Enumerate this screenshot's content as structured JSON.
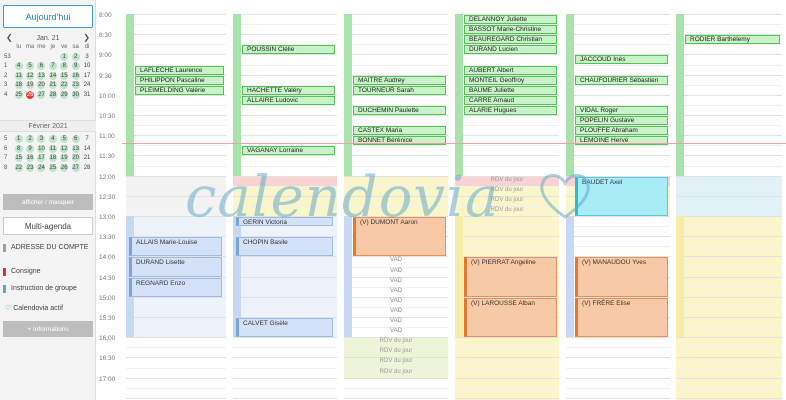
{
  "sidebar": {
    "today_button": "Aujourd'hui",
    "jan": {
      "title": "Jan. 21",
      "dow": [
        "lu",
        "ma",
        "me",
        "je",
        "ve",
        "sa",
        "di"
      ],
      "weeks": [
        {
          "wk": "53",
          "days": [
            "",
            "",
            "",
            "",
            "1",
            "2",
            "3"
          ],
          "av": [
            0,
            0,
            0,
            0,
            1,
            1,
            0
          ]
        },
        {
          "wk": "1",
          "days": [
            "4",
            "5",
            "6",
            "7",
            "8",
            "9",
            "10"
          ],
          "av": [
            1,
            1,
            1,
            1,
            1,
            1,
            0
          ]
        },
        {
          "wk": "2",
          "days": [
            "11",
            "12",
            "13",
            "14",
            "15",
            "16",
            "17"
          ],
          "av": [
            1,
            1,
            1,
            1,
            1,
            1,
            0
          ]
        },
        {
          "wk": "3",
          "days": [
            "18",
            "19",
            "20",
            "21",
            "22",
            "23",
            "24"
          ],
          "av": [
            1,
            1,
            1,
            1,
            1,
            1,
            0
          ]
        },
        {
          "wk": "4",
          "days": [
            "25",
            "26",
            "27",
            "28",
            "29",
            "30",
            "31"
          ],
          "av": [
            1,
            2,
            1,
            1,
            1,
            1,
            0
          ]
        }
      ]
    },
    "feb": {
      "title": "Février 2021",
      "weeks": [
        {
          "wk": "5",
          "days": [
            "1",
            "2",
            "3",
            "4",
            "5",
            "6",
            "7"
          ],
          "av": [
            1,
            1,
            1,
            1,
            1,
            1,
            0
          ]
        },
        {
          "wk": "6",
          "days": [
            "8",
            "9",
            "10",
            "11",
            "12",
            "13",
            "14"
          ],
          "av": [
            1,
            1,
            1,
            1,
            1,
            1,
            0
          ]
        },
        {
          "wk": "7",
          "days": [
            "15",
            "16",
            "17",
            "18",
            "19",
            "20",
            "21"
          ],
          "av": [
            1,
            1,
            1,
            1,
            1,
            1,
            0
          ]
        },
        {
          "wk": "8",
          "days": [
            "22",
            "23",
            "24",
            "25",
            "26",
            "27",
            "28"
          ],
          "av": [
            1,
            1,
            1,
            1,
            1,
            1,
            0
          ]
        }
      ]
    },
    "toggle_button": "afficher / masquer",
    "multi_agenda": "Multi-agenda",
    "legend": [
      {
        "label": "ADRESSE DU COMPTE",
        "color": "#9e9e9e"
      },
      {
        "label": "Consigne",
        "color": "#d9342b"
      },
      {
        "label": "Instruction de groupe",
        "color": "#5aa7d6"
      },
      {
        "label": "Calendovia actif",
        "color": "#3aa0c8"
      }
    ],
    "info_button": "+ Informations"
  },
  "times": [
    "8:00",
    "8:30",
    "9:00",
    "9:30",
    "10:00",
    "10:30",
    "11:00",
    "11:30",
    "12:00",
    "12:30",
    "13:00",
    "13:30",
    "14:00",
    "14:30",
    "15:00",
    "15:30",
    "16:00",
    "16:30",
    "17:00"
  ],
  "columns": [
    {
      "appts_green": [
        {
          "name": "LAFLÈCHE Laurence",
          "slot": 5
        },
        {
          "name": "PHILIPPON Pascaline",
          "slot": 6
        },
        {
          "name": "PLEIMELDING Valérie",
          "slot": 7
        }
      ],
      "appts_blue": [
        {
          "name": "ALLAIS Marie-Louise",
          "start": 22,
          "len": 2
        },
        {
          "name": "DURAND Lisette",
          "start": 24,
          "len": 2
        },
        {
          "name": "REGNARD Enzo",
          "start": 26,
          "len": 2
        }
      ]
    },
    {
      "appts_green": [
        {
          "name": "POUSSIN Clélie",
          "slot": 3
        },
        {
          "name": "HACHETTE Valéry",
          "slot": 7
        },
        {
          "name": "ALLAIRE Ludovic",
          "slot": 8
        },
        {
          "name": "VAGANAY Lorraine",
          "slot": 13
        }
      ],
      "appts_blue": [
        {
          "name": "GERIN Victoria",
          "start": 20,
          "len": 1
        },
        {
          "name": "CHOPIN Basile",
          "start": 22,
          "len": 2
        },
        {
          "name": "CALVET Gisèle",
          "start": 30,
          "len": 2
        }
      ]
    },
    {
      "appts_green": [
        {
          "name": "MAITRE Audrey",
          "slot": 6
        },
        {
          "name": "TOURNEUR Sarah",
          "slot": 7
        },
        {
          "name": "DUCHEMIN Paulette",
          "slot": 9
        },
        {
          "name": "CASTEX Maria",
          "slot": 11
        },
        {
          "name": "BONNET Bérénice",
          "slot": 12
        }
      ],
      "appts_orange": [
        {
          "name": "(V) DUMONT Aaron",
          "start": 20,
          "len": 4
        }
      ],
      "vad_label": "VAD",
      "rdv_label": "RDV du jour"
    },
    {
      "appts_green": [
        {
          "name": "DELANNOY Juliette",
          "slot": 0
        },
        {
          "name": "BASSOT Marie-Christine",
          "slot": 1
        },
        {
          "name": "BEAUREGARD Christian",
          "slot": 2
        },
        {
          "name": "DURAND Lucien",
          "slot": 3
        },
        {
          "name": "AUBERT Albert",
          "slot": 5
        },
        {
          "name": "MONTEIL Geoffroy",
          "slot": 6
        },
        {
          "name": "BAUME Juliette",
          "slot": 7
        },
        {
          "name": "CARRE Arnaud",
          "slot": 8
        },
        {
          "name": "ALARIE Hugues",
          "slot": 9
        }
      ],
      "appts_orange": [
        {
          "name": "(V) PIERRAT Angeline",
          "start": 24,
          "len": 4
        },
        {
          "name": "(V) LAROUSSE Alban",
          "start": 28,
          "len": 4
        }
      ],
      "rdv_label": "RDV du jour"
    },
    {
      "appts_green": [
        {
          "name": "JACCOUD Inès",
          "slot": 4
        },
        {
          "name": "CHAUFOURIER Sébastien",
          "slot": 6
        },
        {
          "name": "VIDAL Roger",
          "slot": 9
        },
        {
          "name": "POPELIN Gustave",
          "slot": 10
        },
        {
          "name": "PLOUFFE Abraham",
          "slot": 11
        },
        {
          "name": "LEMOINE Hervé",
          "slot": 12
        }
      ],
      "appts_cyan": [
        {
          "name": "BAUDET Axel",
          "start": 16,
          "len": 4
        }
      ],
      "appts_orange": [
        {
          "name": "(V) MANAUDOU Yves",
          "start": 24,
          "len": 4
        },
        {
          "name": "(V) FRÈRE Elise",
          "start": 28,
          "len": 4
        }
      ]
    },
    {
      "appts_green": [
        {
          "name": "RODIER Barthélemy",
          "slot": 2
        }
      ]
    }
  ],
  "watermark": "calendovia",
  "colors": {
    "green": "#c8f2c8",
    "blue": "#d3e2f8",
    "orange": "#f8c9a7",
    "cyan": "#a7ecf7",
    "yellow": "#fbf6c9",
    "pink": "#f9d3d3",
    "accent": "#1f86b8"
  }
}
